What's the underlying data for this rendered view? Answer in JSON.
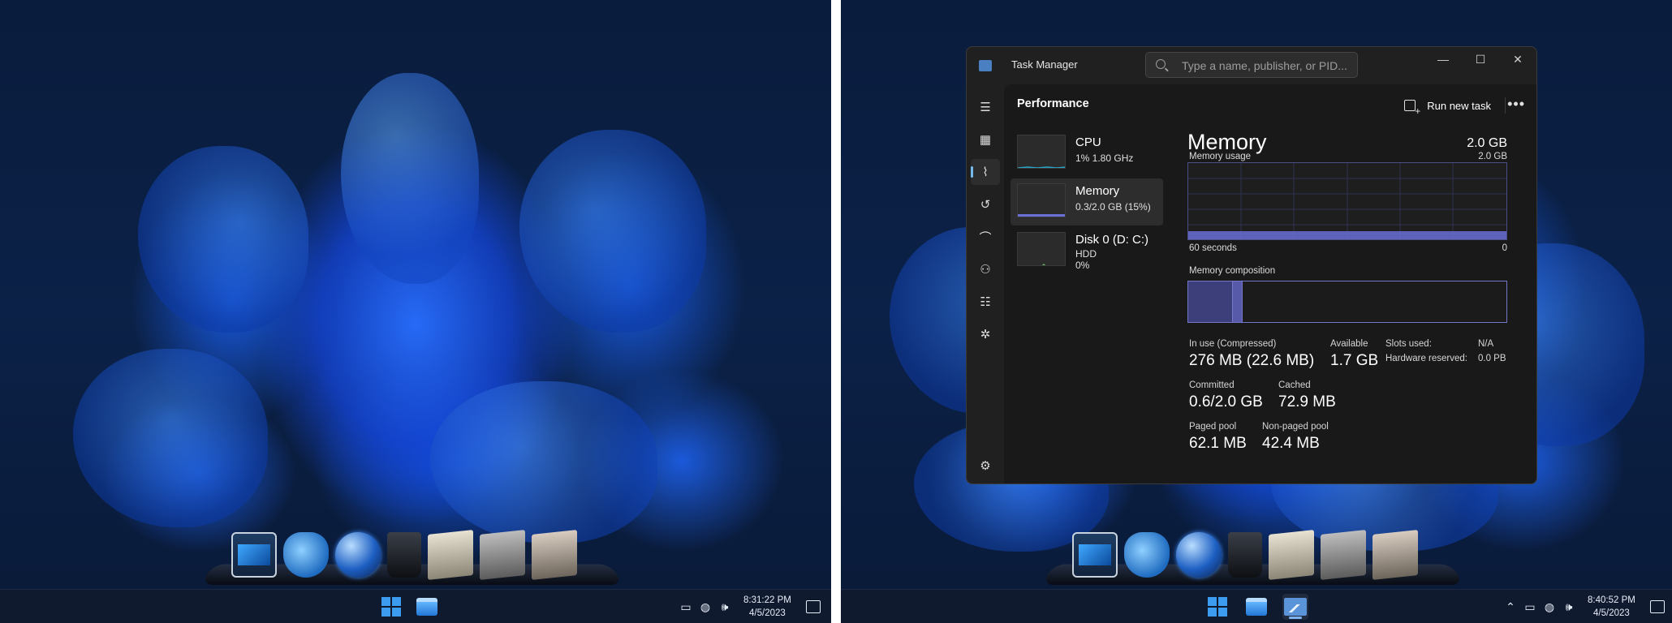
{
  "left_screen": {
    "clock": {
      "time": "8:31:22 PM",
      "date": "4/5/2023"
    }
  },
  "right_screen": {
    "clock": {
      "time": "8:40:52 PM",
      "date": "4/5/2023"
    },
    "task_manager": {
      "title": "Task Manager",
      "search": {
        "placeholder": "Type a name, publisher, or PID..."
      },
      "window_controls": {
        "minimize": "—",
        "maximize": "☐",
        "close": "✕"
      },
      "header": {
        "title": "Performance",
        "run_new_task": "Run new task",
        "more": "•••"
      },
      "perf_items": [
        {
          "name": "CPU",
          "sub1": "1%  1.80 GHz",
          "sub2": ""
        },
        {
          "name": "Memory",
          "sub1": "0.3/2.0 GB (15%)",
          "sub2": ""
        },
        {
          "name": "Disk 0 (D: C:)",
          "sub1": "HDD",
          "sub2": "0%"
        }
      ],
      "memory": {
        "title": "Memory",
        "capacity": "2.0 GB",
        "usage_label": "Memory usage",
        "usage_max": "2.0 GB",
        "graph_left": "60 seconds",
        "graph_right": "0",
        "usage_fraction": 0.15,
        "composition_label": "Memory composition",
        "composition_in_use_fraction": 0.14,
        "composition_modified_fraction": 0.03,
        "stats": {
          "in_use_label": "In use (Compressed)",
          "in_use_value": "276 MB (22.6 MB)",
          "available_label": "Available",
          "available_value": "1.7 GB",
          "slots_label": "Slots used:",
          "slots_value": "N/A",
          "hw_reserved_label": "Hardware reserved:",
          "hw_reserved_value": "0.0 PB",
          "committed_label": "Committed",
          "committed_value": "0.6/2.0 GB",
          "cached_label": "Cached",
          "cached_value": "72.9 MB",
          "paged_label": "Paged pool",
          "paged_value": "62.1 MB",
          "nonpaged_label": "Non-paged pool",
          "nonpaged_value": "42.4 MB"
        }
      }
    }
  },
  "colors": {
    "accent": "#76b9ed",
    "memory_graph": "#6a6fd6",
    "cpu_graph": "#2aa6c8",
    "disk_graph": "#5fb85f"
  }
}
